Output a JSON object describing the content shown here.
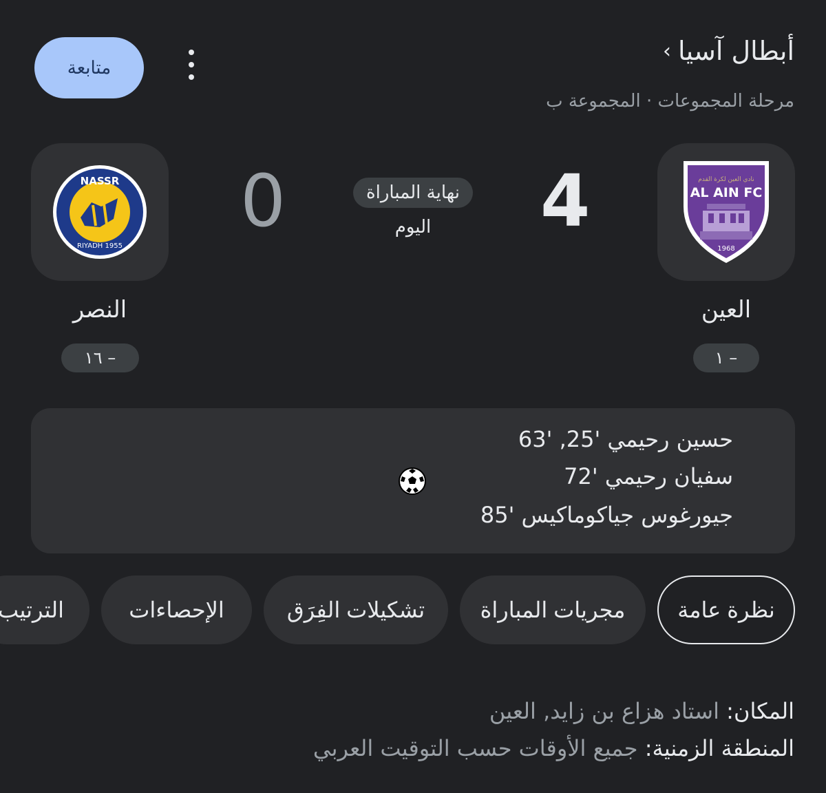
{
  "header": {
    "competition": "أبطال آسيا",
    "competition_chevron": "›",
    "stage": "مرحلة المجموعات · المجموعة ب",
    "follow_label": "متابعة"
  },
  "match": {
    "status": "نهاية المباراة",
    "date": "اليوم",
    "home": {
      "name": "العين",
      "score": "4",
      "rank": "– ١",
      "logo_text": "AL AIN FC",
      "logo_year": "1968",
      "logo_color": "#6a3d9a"
    },
    "away": {
      "name": "النصر",
      "score": "0",
      "rank": "– ١٦",
      "logo_text": "NASSR",
      "logo_sub": "RIYADH 1955",
      "logo_color": "#1e3a8a"
    }
  },
  "goals": [
    "حسين رحيمي '25, '63",
    "سفيان رحيمي '72",
    "جيورغوس جياكوماكيس '85"
  ],
  "tabs": [
    {
      "label": "نظرة عامة",
      "active": true
    },
    {
      "label": "مجريات المباراة",
      "active": false
    },
    {
      "label": "تشكيلات الفِرَق",
      "active": false
    },
    {
      "label": "الإحصاءات",
      "active": false
    },
    {
      "label": "الترتيب",
      "active": false
    }
  ],
  "info": {
    "venue_key": "المكان:",
    "venue_val": "استاد هزاع بن زايد, العين",
    "tz_key": "المنطقة الزمنية:",
    "tz_val": "جميع الأوقات حسب التوقيت العربي"
  },
  "colors": {
    "accent": "#a8c7fa",
    "bg": "#202124",
    "card": "#303134"
  }
}
